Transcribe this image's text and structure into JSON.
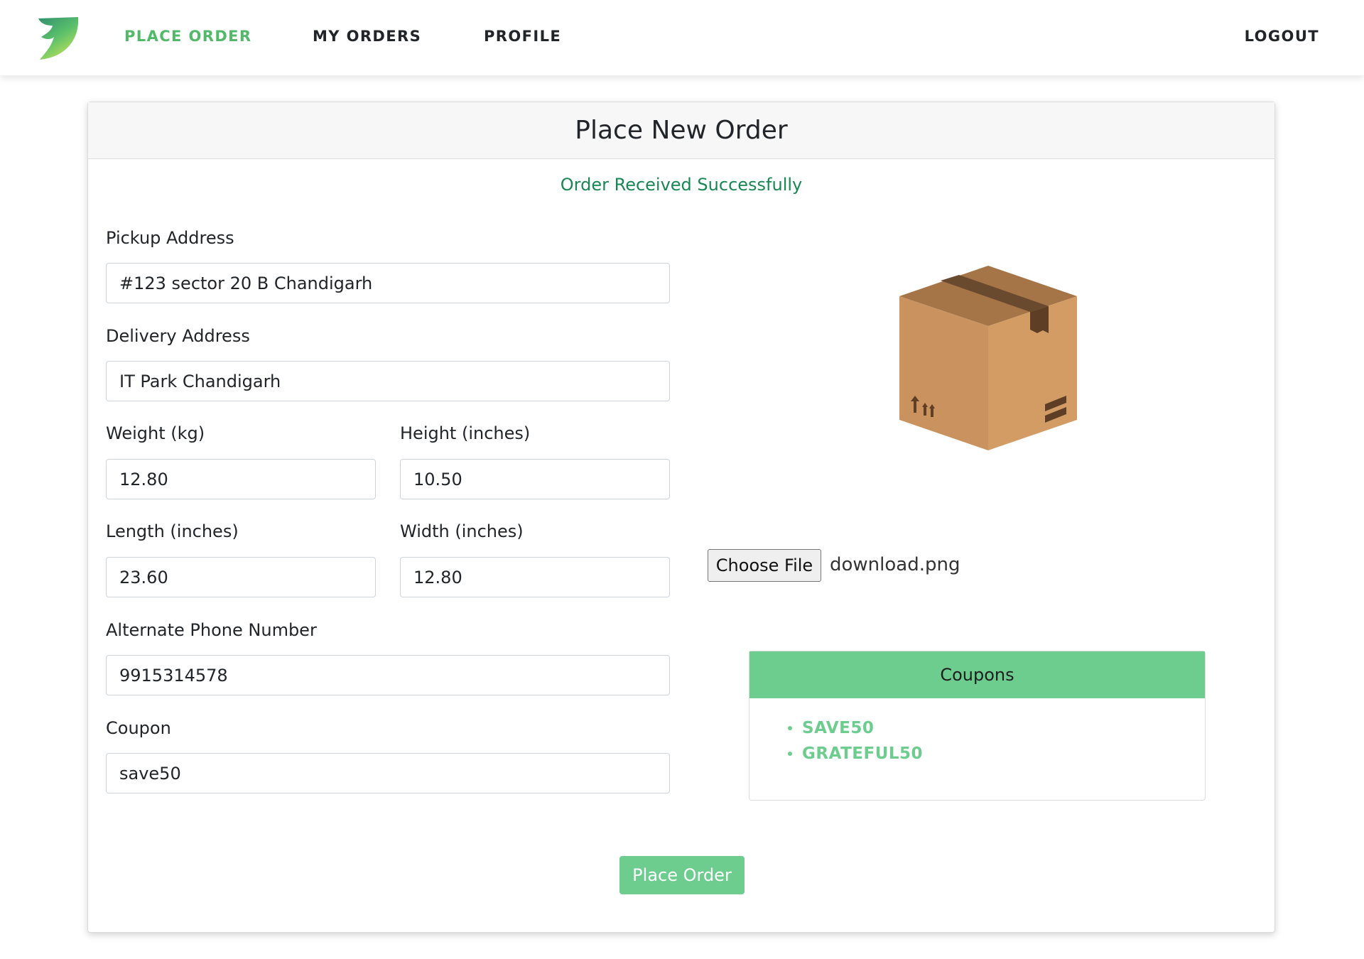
{
  "nav": {
    "logo": "leaf-logo-icon",
    "place_order": "PLACE ORDER",
    "my_orders": "MY ORDERS",
    "profile": "PROFILE",
    "logout": "LOGOUT",
    "active_color": "#52b96b"
  },
  "card": {
    "title": "Place New Order",
    "success_message": "Order Received Successfully"
  },
  "form": {
    "pickup": {
      "label": "Pickup Address",
      "value": "#123 sector 20 B Chandigarh"
    },
    "delivery": {
      "label": "Delivery Address",
      "value": "IT Park Chandigarh"
    },
    "weight": {
      "label": "Weight (kg)",
      "value": "12.80"
    },
    "height": {
      "label": "Height (inches)",
      "value": "10.50"
    },
    "length": {
      "label": "Length (inches)",
      "value": "23.60"
    },
    "width": {
      "label": "Width (inches)",
      "value": "12.80"
    },
    "phone": {
      "label": "Alternate Phone Number",
      "value": "9915314578"
    },
    "coupon": {
      "label": "Coupon",
      "value": "save50"
    },
    "submit_label": "Place Order"
  },
  "upload": {
    "illustration": "cardboard-box-icon",
    "button_label": "Choose File",
    "file_name": "download.png"
  },
  "coupons": {
    "title": "Coupons",
    "items": [
      "SAVE50",
      "GRATEFUL50"
    ],
    "accent_color": "#6dcd8f"
  }
}
